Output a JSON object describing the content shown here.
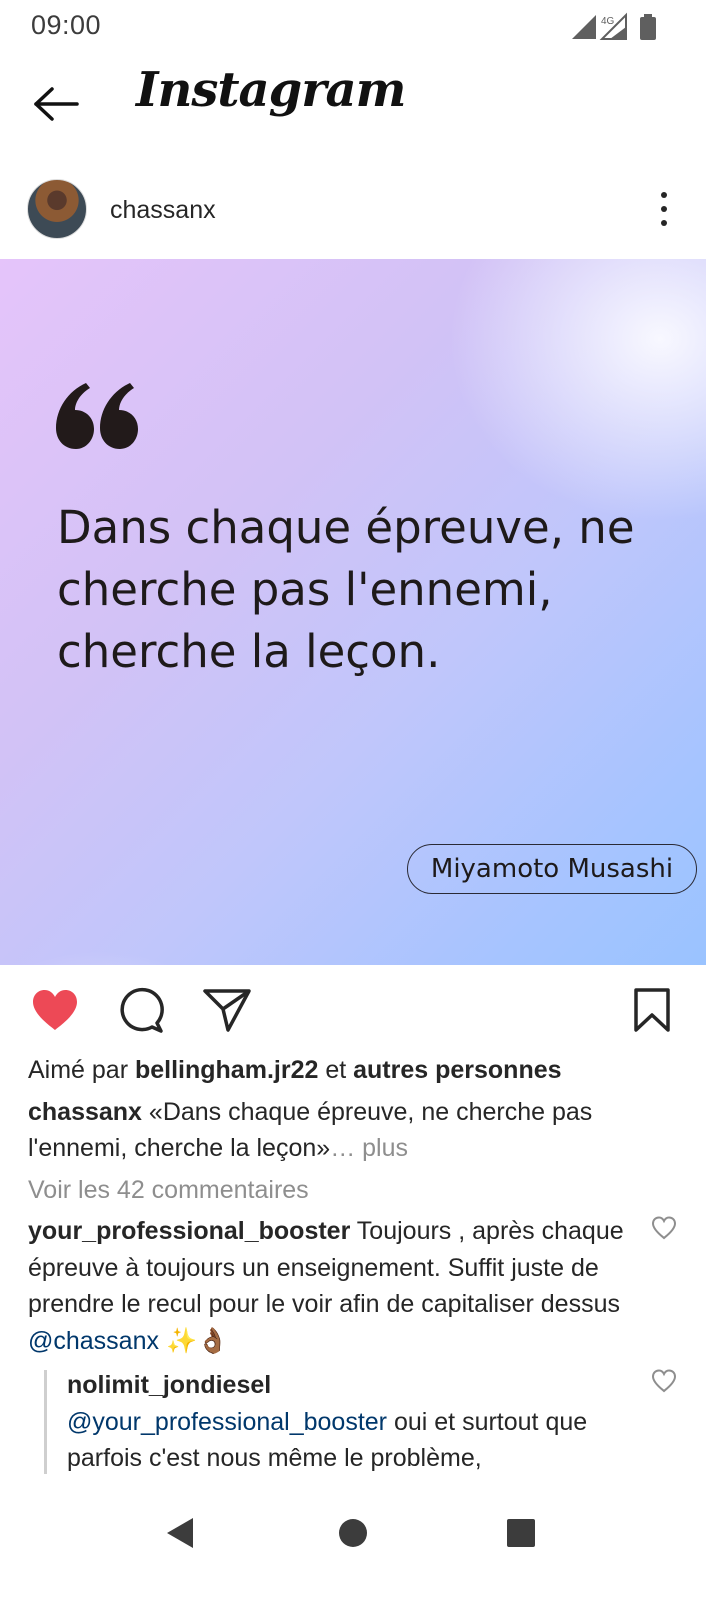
{
  "status_bar": {
    "time": "09:00",
    "network": "4G"
  },
  "header": {
    "title": "Instagram"
  },
  "post": {
    "username": "chassanx",
    "quote": "Dans chaque épreuve, ne cherche pas l'ennemi, cherche la leçon.",
    "author": "Miyamoto Musashi",
    "liked": true
  },
  "likes": {
    "prefix": "Aimé par ",
    "user": "bellingham.jr22",
    "middle": " et ",
    "others": "autres personnes"
  },
  "caption": {
    "user": "chassanx",
    "text": " «Dans chaque épreuve, ne cherche pas l'ennemi, cherche la leçon»",
    "more": "… plus"
  },
  "view_comments": "Voir les 42 commentaires",
  "comments": [
    {
      "user": "your_professional_booster",
      "text": " Toujours , après chaque épreuve à toujours un enseignement. Suffit juste de prendre le recul pour le voir afin de capitaliser dessus ",
      "mention": "@chassanx",
      "emoji": " ✨👌🏾"
    }
  ],
  "replies": [
    {
      "user": "nolimit_jondiesel",
      "mention": "@your_professional_booster",
      "text": " oui et surtout que parfois c'est nous même le problème,"
    }
  ],
  "colors": {
    "like_red": "#ed4956",
    "mention_blue": "#00376b",
    "muted": "#8e8e8e"
  }
}
